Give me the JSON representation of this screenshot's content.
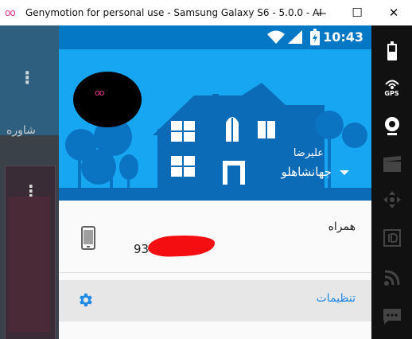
{
  "window": {
    "title": "Genymotion for personal use - Samsung Galaxy S6 - 5.0.0 - API 2...",
    "logo": "oo",
    "minimize": "—",
    "maximize": "☐",
    "close": "✕"
  },
  "status_bar": {
    "time": "10:43"
  },
  "background_app": {
    "text": "شاوره"
  },
  "drawer": {
    "avatar_mark": "oo",
    "user_first_name": "علیرضا",
    "user_last_name": "جهانشاهلو",
    "contact": {
      "label": "همراه",
      "value_visible": "93"
    },
    "settings_label": "تنظیمات"
  },
  "toolbar": {
    "gps_label": "GPS"
  },
  "icons": {
    "phone": "smartphone-icon",
    "settings": "gear-icon",
    "wifi": "wifi-icon",
    "signal": "signal-icon",
    "battery": "battery-icon"
  },
  "colors": {
    "header": "#17a6f2",
    "status_bar": "#0477c5",
    "accent": "#1e88e5",
    "redaction": "#f40e12"
  }
}
